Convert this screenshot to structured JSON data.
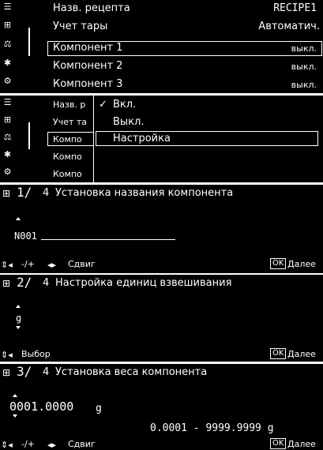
{
  "menu": {
    "rows": [
      {
        "label": "Назв. рецепта",
        "value": "RECIPE1"
      },
      {
        "label": "Учет тары",
        "value": "Автоматич."
      },
      {
        "label": "Компонент 1",
        "value": "выкл."
      },
      {
        "label": "Компонент 2",
        "value": "выкл."
      },
      {
        "label": "Компонент 3",
        "value": "выкл."
      }
    ],
    "icons": [
      "list-icon",
      "calculator-icon",
      "weigh-settings-icon",
      "gear-icon",
      "user-settings-icon"
    ]
  },
  "popup": {
    "rows_left": [
      "Назв. р",
      "Учет та",
      "Компо",
      "Компо",
      "Компо"
    ],
    "options": [
      {
        "label": "Вкл.",
        "checked": "✓"
      },
      {
        "label": "Выкл.",
        "checked": ""
      },
      {
        "label": "Настройка",
        "checked": ""
      }
    ]
  },
  "step1": {
    "step": "1/",
    "total": "4",
    "title": "Установка названия компонента",
    "value": "N001",
    "keys_a": "-/+",
    "keys_b": "Сдвиг",
    "ok": "OK",
    "next": "Далее"
  },
  "step2": {
    "step": "2/",
    "total": "4",
    "title": "Настройка единиц взвешивания",
    "value": "g",
    "keys_a": "Выбор",
    "ok": "OK",
    "next": "Далее"
  },
  "step3": {
    "step": "3/",
    "total": "4",
    "title": "Установка веса компонента",
    "value": "0001.0000",
    "unit": "g",
    "range": "0.0001 - 9999.9999 g",
    "keys_a": "-/+",
    "keys_b": "Сдвиг",
    "ok": "OK",
    "next": "Далее"
  }
}
